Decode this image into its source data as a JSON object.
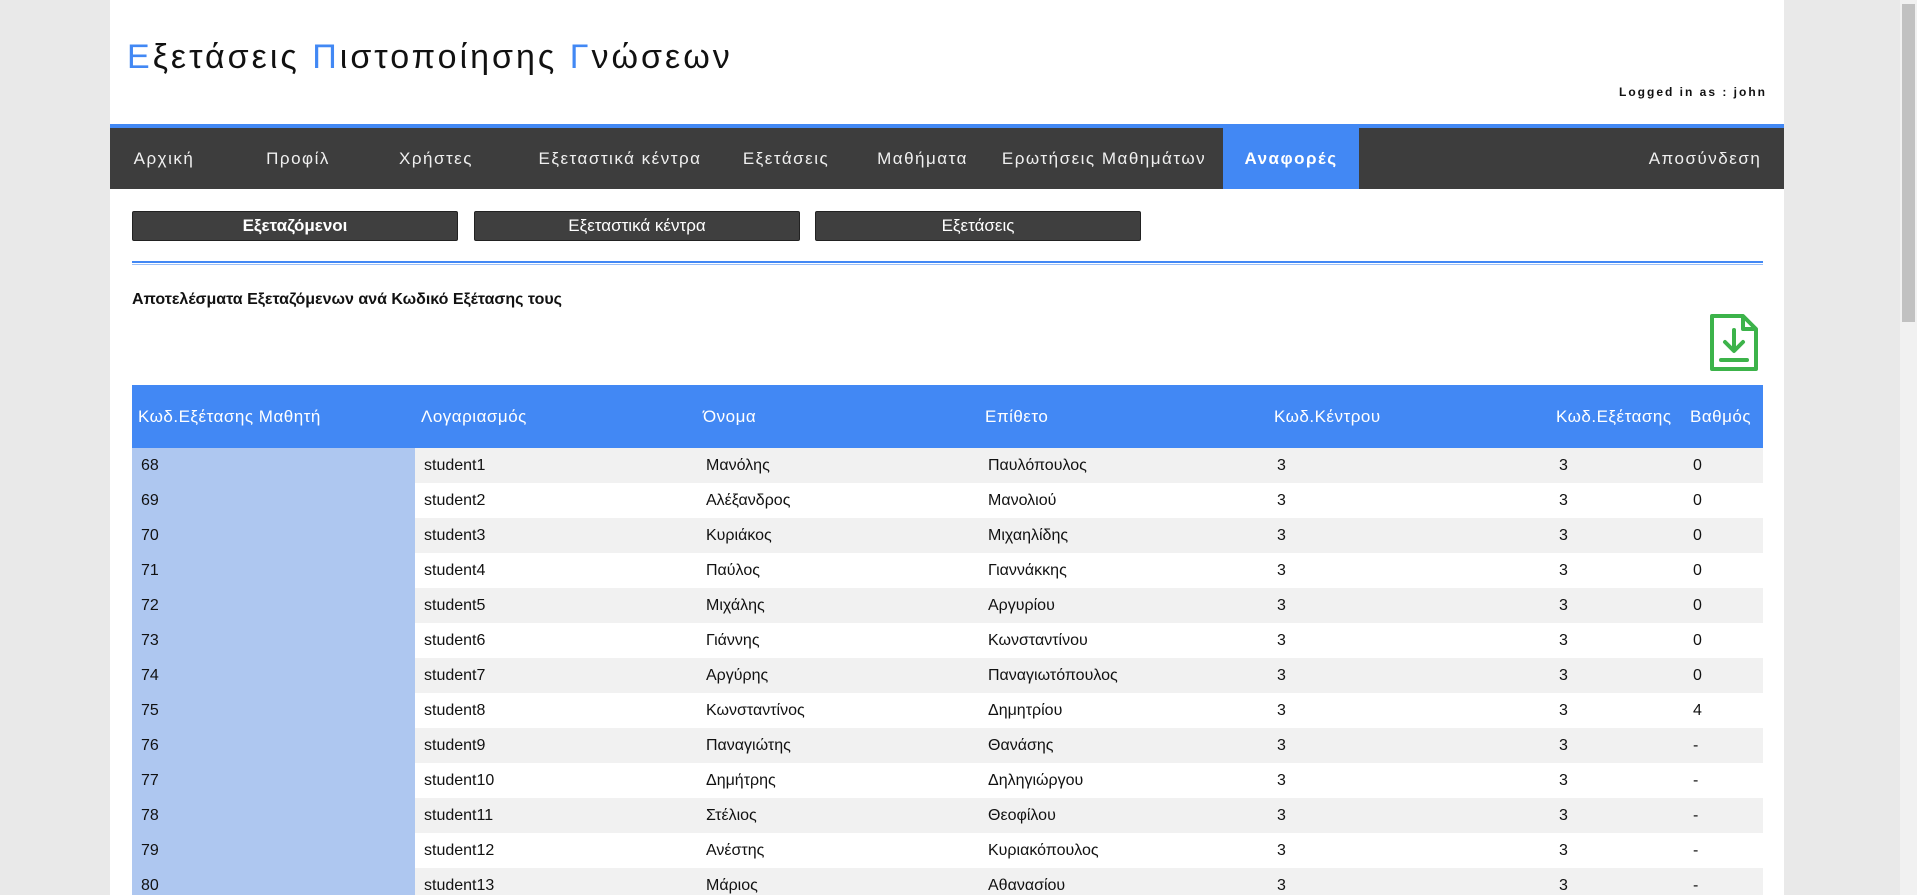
{
  "header": {
    "title_parts": [
      {
        "cap": "Ε",
        "rest": "ξετάσεις "
      },
      {
        "cap": "Π",
        "rest": "ιστοποίησης "
      },
      {
        "cap": "Γ",
        "rest": "νώσεων"
      }
    ],
    "logged_in": "Logged in as : john"
  },
  "nav": {
    "items": [
      {
        "label": "Αρχική"
      },
      {
        "label": "Προφίλ"
      },
      {
        "label": "Χρήστες"
      },
      {
        "label": "Εξεταστικά κέντρα"
      },
      {
        "label": "Εξετάσεις"
      },
      {
        "label": "Μαθήματα"
      },
      {
        "label": "Ερωτήσεις Μαθημάτων"
      },
      {
        "label": "Αναφορές"
      }
    ],
    "active": "Αναφορές",
    "logout": "Αποσύνδεση"
  },
  "subtabs": [
    {
      "label": "Εξεταζόμενοι"
    },
    {
      "label": "Εξεταστικά κέντρα"
    },
    {
      "label": "Εξετάσεις"
    }
  ],
  "report": {
    "title": "Αποτελέσματα Εξεταζόμενων ανά Κωδικό Εξέτασης τους",
    "download_icon": "download-file-icon",
    "columns": [
      "Κωδ.Εξέτασης Μαθητή",
      "Λογαριασμός",
      "Όνομα",
      "Επίθετο",
      "Κωδ.Κέντρου",
      "Κωδ.Εξέτασης",
      "Βαθμός"
    ],
    "rows": [
      [
        "68",
        "student1",
        "Μανόλης",
        "Παυλόπουλος",
        "3",
        "3",
        "0"
      ],
      [
        "69",
        "student2",
        "Αλέξανδρος",
        "Μανολιού",
        "3",
        "3",
        "0"
      ],
      [
        "70",
        "student3",
        "Κυριάκος",
        "Μιχαηλίδης",
        "3",
        "3",
        "0"
      ],
      [
        "71",
        "student4",
        "Παύλος",
        "Γιαννάκκης",
        "3",
        "3",
        "0"
      ],
      [
        "72",
        "student5",
        "Μιχάλης",
        "Αργυρίου",
        "3",
        "3",
        "0"
      ],
      [
        "73",
        "student6",
        "Γιάννης",
        "Κωνσταντίνου",
        "3",
        "3",
        "0"
      ],
      [
        "74",
        "student7",
        "Αργύρης",
        "Παναγιωτόπουλος",
        "3",
        "3",
        "0"
      ],
      [
        "75",
        "student8",
        "Κωνσταντίνος",
        "Δημητρίου",
        "3",
        "3",
        "4"
      ],
      [
        "76",
        "student9",
        "Παναγιώτης",
        "Θανάσης",
        "3",
        "3",
        "-"
      ],
      [
        "77",
        "student10",
        "Δημήτρης",
        "Δηληγιώργου",
        "3",
        "3",
        "-"
      ],
      [
        "78",
        "student11",
        "Στέλιος",
        "Θεοφίλου",
        "3",
        "3",
        "-"
      ],
      [
        "79",
        "student12",
        "Ανέστης",
        "Κυριακόπουλος",
        "3",
        "3",
        "-"
      ],
      [
        "80",
        "student13",
        "Μάριος",
        "Αθανασίου",
        "3",
        "3",
        "-"
      ]
    ]
  },
  "colors": {
    "accent": "#4288f4",
    "nav_bg": "#3d3d3d",
    "first_col": "#aec7f0",
    "icon_green": "#3cb34a"
  }
}
